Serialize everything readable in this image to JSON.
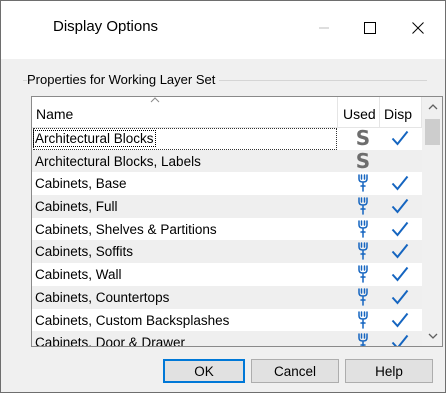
{
  "window": {
    "title": "Display Options"
  },
  "group": {
    "label": "Properties for  Working Layer Set"
  },
  "list": {
    "columns": {
      "name": "Name",
      "used": "Used",
      "disp": "Disp"
    },
    "rows": [
      {
        "name": "Architectural Blocks",
        "used": "S",
        "displayed": true,
        "focused": true
      },
      {
        "name": "Architectural Blocks, Labels",
        "used": "S",
        "displayed": false
      },
      {
        "name": "Cabinets,  Base",
        "used": "wrench",
        "displayed": true
      },
      {
        "name": "Cabinets,  Full",
        "used": "wrench",
        "displayed": true
      },
      {
        "name": "Cabinets,  Shelves & Partitions",
        "used": "wrench",
        "displayed": true
      },
      {
        "name": "Cabinets,  Soffits",
        "used": "wrench",
        "displayed": true
      },
      {
        "name": "Cabinets,  Wall",
        "used": "wrench",
        "displayed": true
      },
      {
        "name": "Cabinets, Countertops",
        "used": "wrench",
        "displayed": true
      },
      {
        "name": "Cabinets, Custom Backsplashes",
        "used": "wrench",
        "displayed": true
      },
      {
        "name": "Cabinets, Door & Drawer",
        "used": "wrench",
        "displayed": true
      }
    ]
  },
  "buttons": {
    "ok": "OK",
    "cancel": "Cancel",
    "help": "Help"
  },
  "colors": {
    "checkmark": "#1565c0",
    "wrench": "#1565c0",
    "s_icon": "#6d6d6d",
    "focus_border": "#0078d7"
  }
}
